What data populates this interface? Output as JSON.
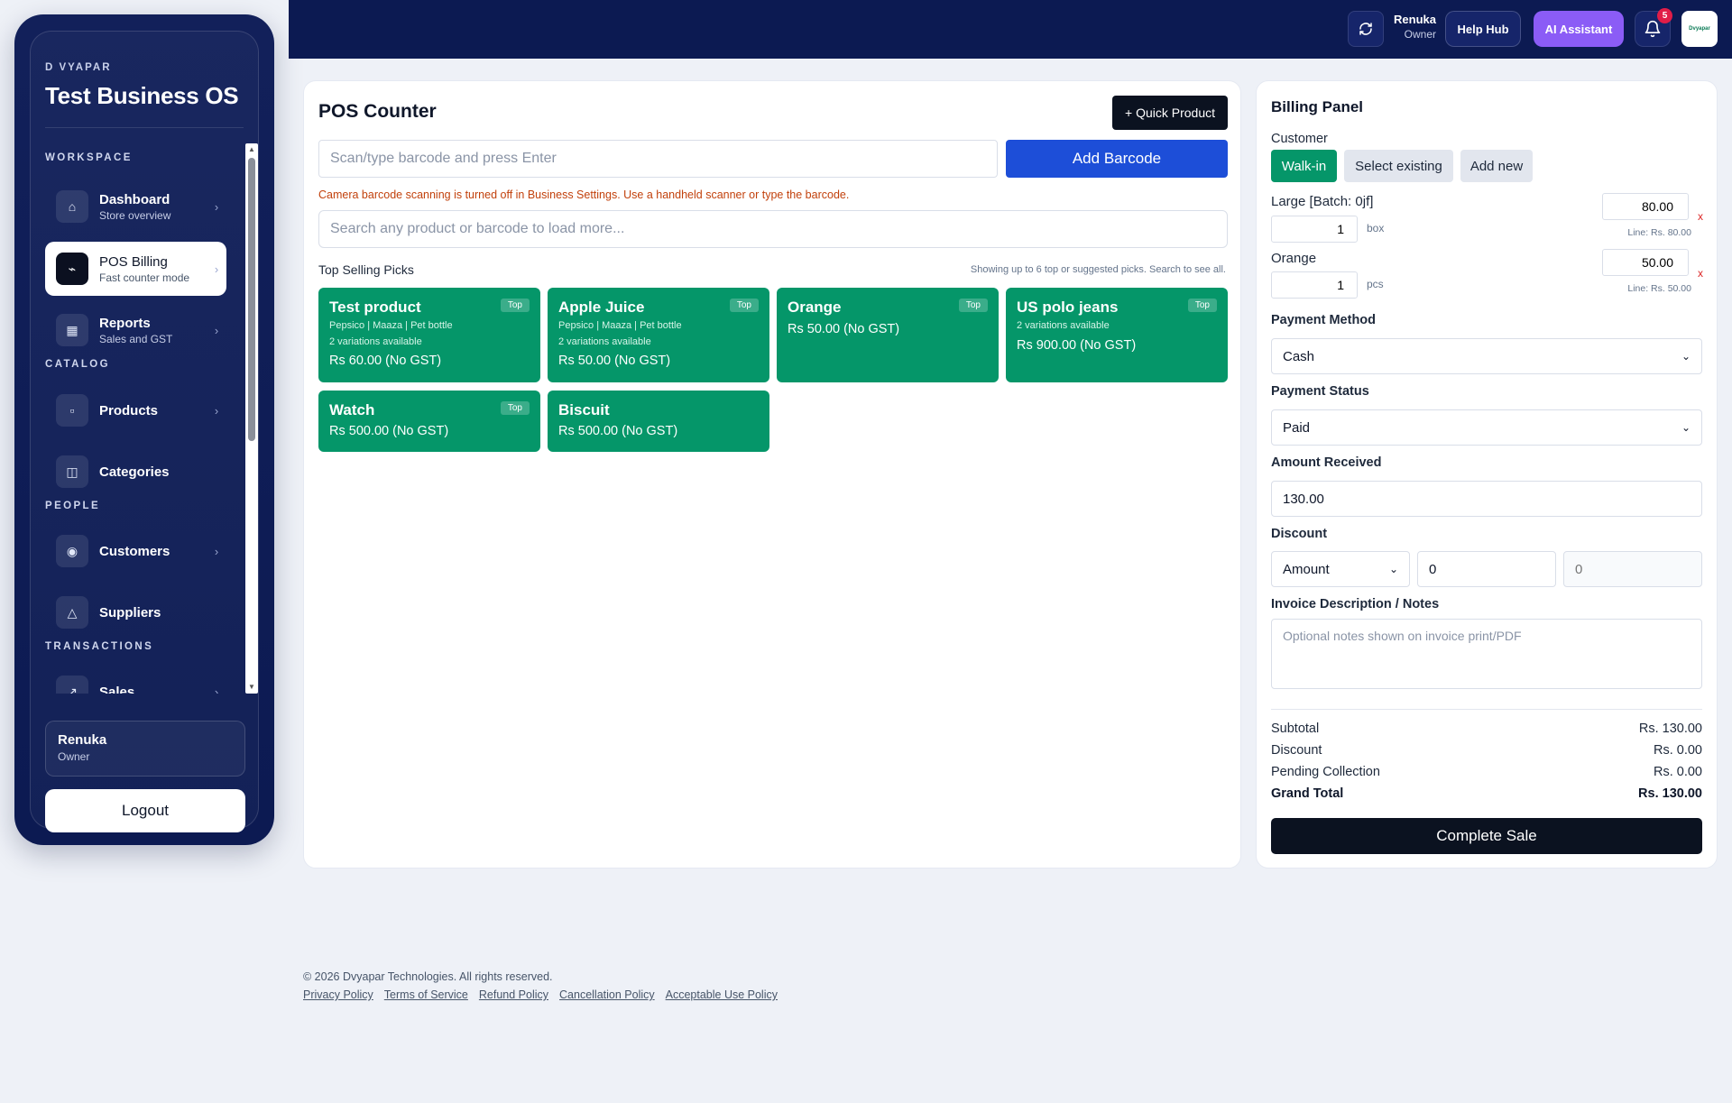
{
  "sidebar": {
    "brand_small": "D VYAPAR",
    "brand_title": "Test Business OS",
    "sections": {
      "workspace": "WORKSPACE",
      "catalog": "CATALOG",
      "people": "PEOPLE",
      "transactions": "TRANSACTIONS"
    },
    "items": [
      {
        "label": "Dashboard",
        "sub": "Store overview",
        "icon": "home-icon",
        "glyph": "⌂"
      },
      {
        "label": "POS Billing",
        "sub": "Fast counter mode",
        "icon": "pos-icon",
        "glyph": "⌁"
      },
      {
        "label": "Reports",
        "sub": "Sales and GST",
        "icon": "reports-icon",
        "glyph": "▦"
      },
      {
        "label": "Products",
        "sub": "",
        "icon": "box-icon",
        "glyph": "▫"
      },
      {
        "label": "Categories",
        "sub": "",
        "icon": "columns-icon",
        "glyph": "◫"
      },
      {
        "label": "Customers",
        "sub": "",
        "icon": "user-icon",
        "glyph": "◉"
      },
      {
        "label": "Suppliers",
        "sub": "",
        "icon": "triangle-icon",
        "glyph": "△"
      },
      {
        "label": "Sales",
        "sub": "",
        "icon": "trend-icon",
        "glyph": "↗"
      }
    ],
    "active_item": "POS Billing",
    "user": {
      "name": "Renuka",
      "role": "Owner"
    },
    "logout_label": "Logout"
  },
  "header": {
    "user_name": "Renuka",
    "user_role": "Owner",
    "help_label": "Help Hub",
    "ai_label": "AI Assistant",
    "notification_count": "5",
    "logo_text": "Dvyapar"
  },
  "pos": {
    "title": "POS Counter",
    "quick_product_label": "+ Quick Product",
    "barcode_placeholder": "Scan/type barcode and press Enter",
    "add_barcode_label": "Add Barcode",
    "camera_note": "Camera barcode scanning is turned off in Business Settings. Use a handheld scanner or type the barcode.",
    "search_placeholder": "Search any product or barcode to load more...",
    "picks_title": "Top Selling Picks",
    "picks_note": "Showing up to 6 top or suggested picks. Search to see all.",
    "picks": [
      {
        "name": "Test product",
        "badge": "Top",
        "meta1": "Pepsico | Maaza | Pet bottle",
        "meta2": "2 variations available",
        "price": "Rs 60.00 (No GST)"
      },
      {
        "name": "Apple Juice",
        "badge": "Top",
        "meta1": "Pepsico | Maaza | Pet bottle",
        "meta2": "2 variations available",
        "price": "Rs 50.00 (No GST)"
      },
      {
        "name": "Orange",
        "badge": "Top",
        "meta1": "",
        "meta2": "",
        "price": "Rs 50.00 (No GST)"
      },
      {
        "name": "US polo jeans",
        "badge": "Top",
        "meta1": "2 variations available",
        "meta2": "",
        "price": "Rs 900.00 (No GST)"
      },
      {
        "name": "Watch",
        "badge": "Top",
        "meta1": "",
        "meta2": "",
        "price": "Rs 500.00 (No GST)"
      },
      {
        "name": "Biscuit",
        "badge": "",
        "meta1": "",
        "meta2": "",
        "price": "Rs 500.00 (No GST)"
      }
    ]
  },
  "billing": {
    "title": "Billing Panel",
    "customer_label": "Customer",
    "customer_options": [
      "Walk-in",
      "Select existing",
      "Add new"
    ],
    "lines": [
      {
        "name": "Large [Batch: 0jf]",
        "qty": "1",
        "unit": "box",
        "price": "80.00",
        "line_total": "Line: Rs. 80.00",
        "remove": "x"
      },
      {
        "name": "Orange",
        "qty": "1",
        "unit": "pcs",
        "price": "50.00",
        "line_total": "Line: Rs. 50.00",
        "remove": "x"
      }
    ],
    "payment_method_label": "Payment Method",
    "payment_method_value": "Cash",
    "payment_status_label": "Payment Status",
    "payment_status_value": "Paid",
    "amount_received_label": "Amount Received",
    "amount_received_value": "130.00",
    "discount_label": "Discount",
    "discount_type": "Amount",
    "discount_value": "0",
    "discount_computed_placeholder": "0",
    "notes_label": "Invoice Description / Notes",
    "notes_placeholder": "Optional notes shown on invoice print/PDF",
    "summary": [
      {
        "label": "Subtotal",
        "value": "Rs. 130.00"
      },
      {
        "label": "Discount",
        "value": "Rs. 0.00"
      },
      {
        "label": "Pending Collection",
        "value": "Rs. 0.00"
      },
      {
        "label": "Grand Total",
        "value": "Rs. 130.00"
      }
    ],
    "complete_label": "Complete Sale"
  },
  "footer": {
    "copyright": "© 2026 Dvyapar Technologies. All rights reserved.",
    "links": [
      "Privacy Policy",
      "Terms of Service",
      "Refund Policy",
      "Cancellation Policy",
      "Acceptable Use Policy"
    ]
  },
  "colors": {
    "navy": "#0c1a52",
    "accent_green": "#059669",
    "accent_blue": "#1d4ed8",
    "ai_purple": "#8b5cf6",
    "warning": "#c2410c"
  }
}
